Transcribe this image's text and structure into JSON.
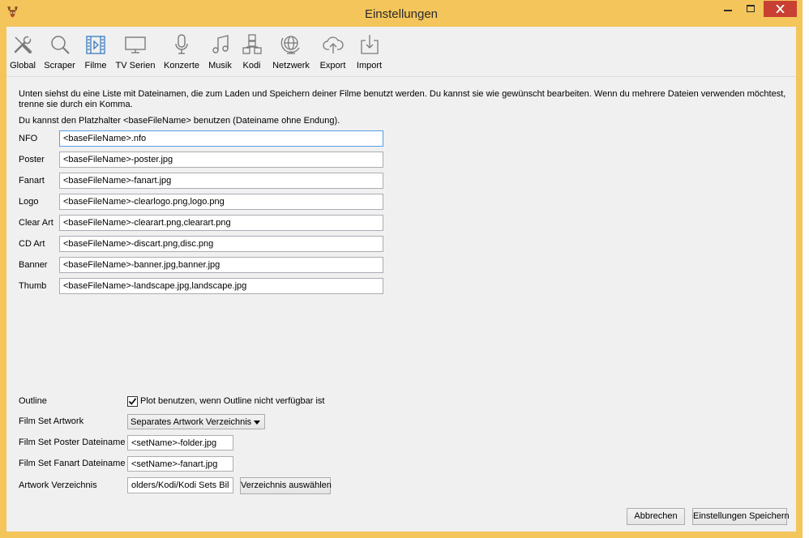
{
  "window": {
    "title": "Einstellungen",
    "app_icon": "reindeer-icon",
    "frame_color": "#f4c55b",
    "close_color": "#c84031"
  },
  "toolbar": {
    "items": [
      {
        "label": "Global",
        "icon": "tools-icon",
        "selected": false
      },
      {
        "label": "Scraper",
        "icon": "search-icon",
        "selected": false
      },
      {
        "label": "Filme",
        "icon": "film-icon",
        "selected": true
      },
      {
        "label": "TV Serien",
        "icon": "tv-icon",
        "selected": false
      },
      {
        "label": "Konzerte",
        "icon": "microphone-icon",
        "selected": false
      },
      {
        "label": "Musik",
        "icon": "music-icon",
        "selected": false
      },
      {
        "label": "Kodi",
        "icon": "hierarchy-icon",
        "selected": false
      },
      {
        "label": "Netzwerk",
        "icon": "network-icon",
        "selected": false
      },
      {
        "label": "Export",
        "icon": "cloud-upload-icon",
        "selected": false
      },
      {
        "label": "Import",
        "icon": "import-icon",
        "selected": false
      }
    ],
    "icon_color": "#7a7a7a",
    "selected_icon_color": "#3a7cc0"
  },
  "intro": {
    "text": "Unten siehst du eine Liste mit Dateinamen, die zum Laden und Speichern deiner Filme benutzt werden. Du kannst sie wie gewünscht bearbeiten. Wenn du mehrere Dateien verwenden möchtest, trenne sie durch ein Komma.",
    "placeholder_hint": "Du kannst den Platzhalter <baseFileName> benutzen (Dateiname ohne Endung)."
  },
  "filenames": [
    {
      "label": "NFO",
      "value": "<baseFileName>.nfo",
      "focused": true
    },
    {
      "label": "Poster",
      "value": "<baseFileName>-poster.jpg"
    },
    {
      "label": "Fanart",
      "value": "<baseFileName>-fanart.jpg"
    },
    {
      "label": "Logo",
      "value": "<baseFileName>-clearlogo.png,logo.png"
    },
    {
      "label": "Clear Art",
      "value": "<baseFileName>-clearart.png,clearart.png"
    },
    {
      "label": "CD Art",
      "value": "<baseFileName>-discart.png,disc.png"
    },
    {
      "label": "Banner",
      "value": "<baseFileName>-banner.jpg,banner.jpg"
    },
    {
      "label": "Thumb",
      "value": "<baseFileName>-landscape.jpg,landscape.jpg"
    }
  ],
  "outline": {
    "label": "Outline",
    "checkbox_label": "Plot benutzen, wenn Outline nicht verfügbar ist",
    "checked": true
  },
  "set_artwork": {
    "label": "Film Set Artwork",
    "selected": "Separates Artwork Verzeichnis"
  },
  "set_poster": {
    "label": "Film Set Poster Dateiname",
    "value": "<setName>-folder.jpg"
  },
  "set_fanart": {
    "label": "Film Set Fanart Dateiname",
    "value": "<setName>-fanart.jpg"
  },
  "artwork_dir": {
    "label": "Artwork Verzeichnis",
    "value": "olders/Kodi/Kodi Sets Bilder",
    "button_label": "Verzeichnis auswählen"
  },
  "footer": {
    "cancel_label": "Abbrechen",
    "save_label": "Einstellungen Speichern"
  }
}
